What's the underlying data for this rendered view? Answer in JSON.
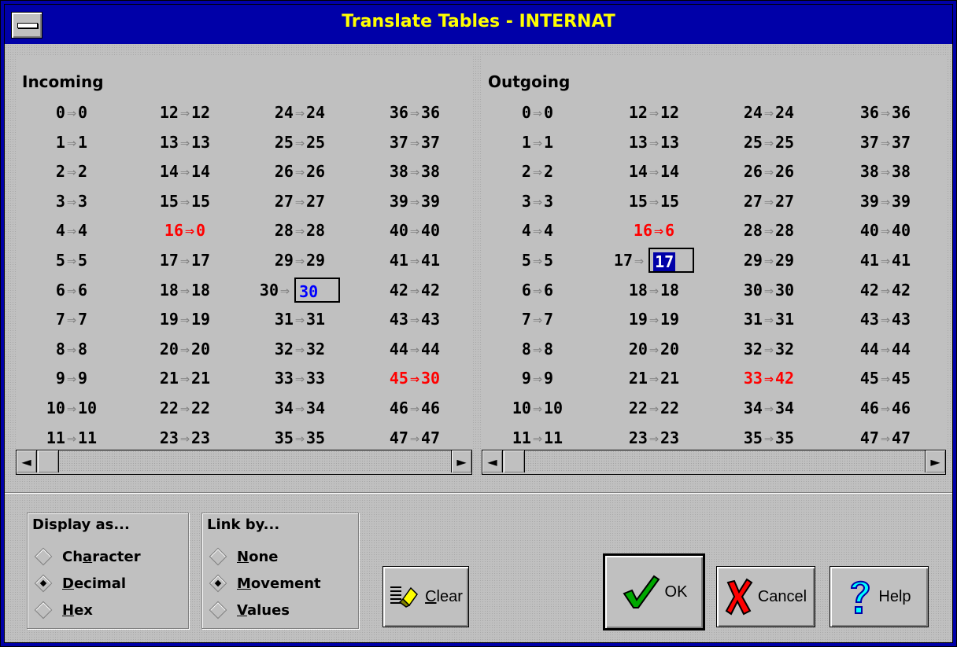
{
  "window": {
    "title": "Translate Tables - INTERNAT"
  },
  "incoming": {
    "header": "Incoming",
    "columns": [
      [
        {
          "l": "0",
          "r": "0"
        },
        {
          "l": "1",
          "r": "1"
        },
        {
          "l": "2",
          "r": "2"
        },
        {
          "l": "3",
          "r": "3"
        },
        {
          "l": "4",
          "r": "4"
        },
        {
          "l": "5",
          "r": "5"
        },
        {
          "l": "6",
          "r": "6"
        },
        {
          "l": "7",
          "r": "7"
        },
        {
          "l": "8",
          "r": "8"
        },
        {
          "l": "9",
          "r": "9"
        },
        {
          "l": "10",
          "r": "10"
        },
        {
          "l": "11",
          "r": "11"
        }
      ],
      [
        {
          "l": "12",
          "r": "12"
        },
        {
          "l": "13",
          "r": "13"
        },
        {
          "l": "14",
          "r": "14"
        },
        {
          "l": "15",
          "r": "15"
        },
        {
          "l": "16",
          "r": "0",
          "red": true
        },
        {
          "l": "17",
          "r": "17"
        },
        {
          "l": "18",
          "r": "18"
        },
        {
          "l": "19",
          "r": "19"
        },
        {
          "l": "20",
          "r": "20"
        },
        {
          "l": "21",
          "r": "21"
        },
        {
          "l": "22",
          "r": "22"
        },
        {
          "l": "23",
          "r": "23"
        }
      ],
      [
        {
          "l": "24",
          "r": "24"
        },
        {
          "l": "25",
          "r": "25"
        },
        {
          "l": "26",
          "r": "26"
        },
        {
          "l": "27",
          "r": "27"
        },
        {
          "l": "28",
          "r": "28"
        },
        {
          "l": "29",
          "r": "29"
        },
        {
          "l": "30",
          "r": "30",
          "edit": "blue"
        },
        {
          "l": "31",
          "r": "31"
        },
        {
          "l": "32",
          "r": "32"
        },
        {
          "l": "33",
          "r": "33"
        },
        {
          "l": "34",
          "r": "34"
        },
        {
          "l": "35",
          "r": "35"
        }
      ],
      [
        {
          "l": "36",
          "r": "36"
        },
        {
          "l": "37",
          "r": "37"
        },
        {
          "l": "38",
          "r": "38"
        },
        {
          "l": "39",
          "r": "39"
        },
        {
          "l": "40",
          "r": "40"
        },
        {
          "l": "41",
          "r": "41"
        },
        {
          "l": "42",
          "r": "42"
        },
        {
          "l": "43",
          "r": "43"
        },
        {
          "l": "44",
          "r": "44"
        },
        {
          "l": "45",
          "r": "30",
          "red": true
        },
        {
          "l": "46",
          "r": "46"
        },
        {
          "l": "47",
          "r": "47"
        }
      ]
    ]
  },
  "outgoing": {
    "header": "Outgoing",
    "columns": [
      [
        {
          "l": "0",
          "r": "0"
        },
        {
          "l": "1",
          "r": "1"
        },
        {
          "l": "2",
          "r": "2"
        },
        {
          "l": "3",
          "r": "3"
        },
        {
          "l": "4",
          "r": "4"
        },
        {
          "l": "5",
          "r": "5"
        },
        {
          "l": "6",
          "r": "6"
        },
        {
          "l": "7",
          "r": "7"
        },
        {
          "l": "8",
          "r": "8"
        },
        {
          "l": "9",
          "r": "9"
        },
        {
          "l": "10",
          "r": "10"
        },
        {
          "l": "11",
          "r": "11"
        }
      ],
      [
        {
          "l": "12",
          "r": "12"
        },
        {
          "l": "13",
          "r": "13"
        },
        {
          "l": "14",
          "r": "14"
        },
        {
          "l": "15",
          "r": "15"
        },
        {
          "l": "16",
          "r": "6",
          "red": true
        },
        {
          "l": "17",
          "r": "17",
          "edit": "selected"
        },
        {
          "l": "18",
          "r": "18"
        },
        {
          "l": "19",
          "r": "19"
        },
        {
          "l": "20",
          "r": "20"
        },
        {
          "l": "21",
          "r": "21"
        },
        {
          "l": "22",
          "r": "22"
        },
        {
          "l": "23",
          "r": "23"
        }
      ],
      [
        {
          "l": "24",
          "r": "24"
        },
        {
          "l": "25",
          "r": "25"
        },
        {
          "l": "26",
          "r": "26"
        },
        {
          "l": "27",
          "r": "27"
        },
        {
          "l": "28",
          "r": "28"
        },
        {
          "l": "29",
          "r": "29"
        },
        {
          "l": "30",
          "r": "30"
        },
        {
          "l": "31",
          "r": "31"
        },
        {
          "l": "32",
          "r": "32"
        },
        {
          "l": "33",
          "r": "42",
          "red": true
        },
        {
          "l": "34",
          "r": "34"
        },
        {
          "l": "35",
          "r": "35"
        }
      ],
      [
        {
          "l": "36",
          "r": "36"
        },
        {
          "l": "37",
          "r": "37"
        },
        {
          "l": "38",
          "r": "38"
        },
        {
          "l": "39",
          "r": "39"
        },
        {
          "l": "40",
          "r": "40"
        },
        {
          "l": "41",
          "r": "41"
        },
        {
          "l": "42",
          "r": "42"
        },
        {
          "l": "43",
          "r": "43"
        },
        {
          "l": "44",
          "r": "44"
        },
        {
          "l": "45",
          "r": "45"
        },
        {
          "l": "46",
          "r": "46"
        },
        {
          "l": "47",
          "r": "47"
        }
      ]
    ]
  },
  "arrow_glyph": "⇒",
  "display_as": {
    "title": "Display as...",
    "options": [
      {
        "pre": "Ch",
        "key": "a",
        "post": "racter",
        "selected": false
      },
      {
        "pre": "",
        "key": "D",
        "post": "ecimal",
        "selected": true
      },
      {
        "pre": "",
        "key": "H",
        "post": "ex",
        "selected": false
      }
    ]
  },
  "link_by": {
    "title": "Link by...",
    "options": [
      {
        "pre": "",
        "key": "N",
        "post": "one",
        "selected": false
      },
      {
        "pre": "",
        "key": "M",
        "post": "ovement",
        "selected": true
      },
      {
        "pre": "",
        "key": "V",
        "post": "alues",
        "selected": false
      }
    ]
  },
  "buttons": {
    "clear": {
      "key": "C",
      "rest": "lear"
    },
    "ok": "OK",
    "cancel": "Cancel",
    "help": "Help"
  },
  "icons": {
    "scroll_left": "left-arrow-icon",
    "scroll_right": "right-arrow-icon",
    "ok": "checkmark-icon",
    "cancel": "x-icon",
    "help": "question-icon",
    "clear": "eraser-icon"
  },
  "colors": {
    "title_bar": "#0000a8",
    "title_text": "#ffff00",
    "changed": "#ff0000",
    "edit_value": "#0000ff"
  }
}
